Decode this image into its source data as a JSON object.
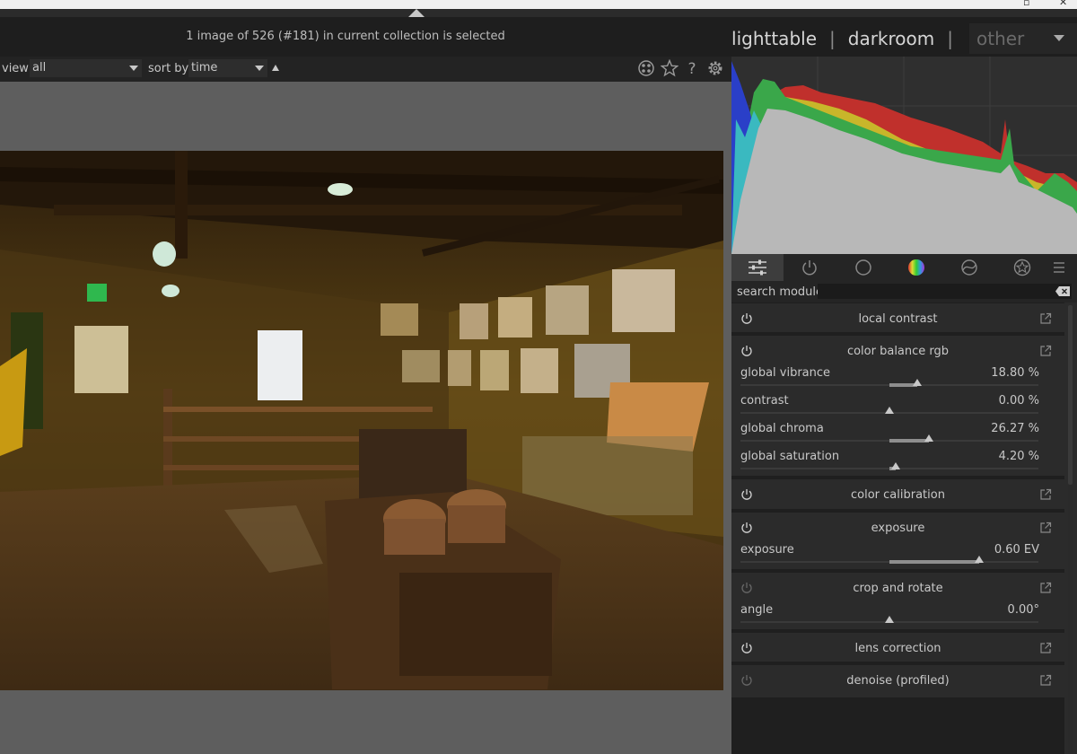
{
  "header": {
    "status_text": "1 image of 526 (#181) in current collection is selected",
    "views": [
      "lighttable",
      "darkroom",
      "other"
    ],
    "separator": "|"
  },
  "toolbar": {
    "view_label": "view",
    "view_value": "all",
    "sort_label": "sort by",
    "sort_value": "time",
    "icons": [
      "color-labels-icon",
      "star-icon",
      "help-icon",
      "gear-icon"
    ]
  },
  "panel": {
    "tabs": [
      "active-modules-icon",
      "power-icon",
      "circle-icon",
      "color-wheel-icon",
      "correct-icon",
      "effects-icon",
      "menu-icon"
    ],
    "search_label": "search module",
    "search_value": "",
    "modules": [
      {
        "title": "local contrast",
        "enabled": true,
        "sliders": []
      },
      {
        "title": "color balance rgb",
        "enabled": true,
        "sliders": [
          {
            "label": "global vibrance",
            "value": "18.80 %",
            "from": 0.0,
            "to": 0.188
          },
          {
            "label": "contrast",
            "value": "0.00 %",
            "from": 0.0,
            "to": 0.0
          },
          {
            "label": "global chroma",
            "value": "26.27 %",
            "from": 0.0,
            "to": 0.2627
          },
          {
            "label": "global saturation",
            "value": "4.20 %",
            "from": 0.0,
            "to": 0.042
          }
        ]
      },
      {
        "title": "color calibration",
        "enabled": true,
        "sliders": []
      },
      {
        "title": "exposure",
        "enabled": true,
        "sliders": [
          {
            "label": "exposure",
            "value": "0.60 EV",
            "from": 0.0,
            "to": 0.6
          }
        ]
      },
      {
        "title": "crop and rotate",
        "enabled": false,
        "sliders": [
          {
            "label": "angle",
            "value": "0.00°",
            "from": 0.0,
            "to": 0.0
          }
        ]
      },
      {
        "title": "lens correction",
        "enabled": true,
        "sliders": []
      },
      {
        "title": "denoise (profiled)",
        "enabled": false,
        "sliders": []
      }
    ]
  },
  "colors": {
    "histogram_red": "#c0302c",
    "histogram_yellow": "#c8b62a",
    "histogram_green": "#3aa74a",
    "histogram_blue": "#2a3fc8",
    "histogram_cyan": "#3ab9c0",
    "histogram_gray": "#b8b8b8"
  }
}
